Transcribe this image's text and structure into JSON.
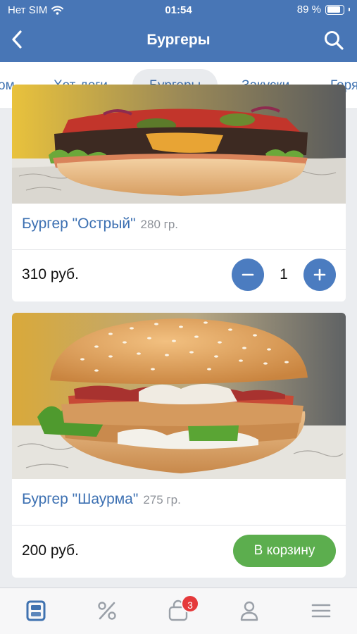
{
  "status_bar": {
    "carrier": "Нет SIM",
    "time": "01:54",
    "battery_text": "89 %",
    "battery_level": 0.89
  },
  "header": {
    "title": "Бургеры",
    "icons": {
      "back": "chevron-left-icon",
      "search": "search-icon"
    }
  },
  "category_tabs": [
    {
      "label": "ом",
      "active": false
    },
    {
      "label": "Хот-доги",
      "active": false
    },
    {
      "label": "Бургеры",
      "active": true
    },
    {
      "label": "Закуски",
      "active": false
    },
    {
      "label": "Горя",
      "active": false
    }
  ],
  "products": [
    {
      "name": "Бургер \"Острый\"",
      "weight": "280 гр.",
      "price": "310 руб.",
      "quantity": "1",
      "image": "spicy-burger-photo"
    },
    {
      "name": "Бургер \"Шаурма\"",
      "weight": "275 гр.",
      "price": "200 руб.",
      "cart_label": "В корзину",
      "image": "shawarma-burger-photo"
    }
  ],
  "bottom_nav": {
    "icons": [
      "menu-card-icon",
      "percent-icon",
      "cart-icon",
      "profile-icon",
      "hamburger-menu-icon"
    ],
    "cart_badge": "3"
  },
  "colors": {
    "header": "#4876b6",
    "accent": "#4b7cc0",
    "add_to_cart": "#5cae4e",
    "badge": "#e5393b",
    "active_nav_icon": "#3f72b0"
  }
}
